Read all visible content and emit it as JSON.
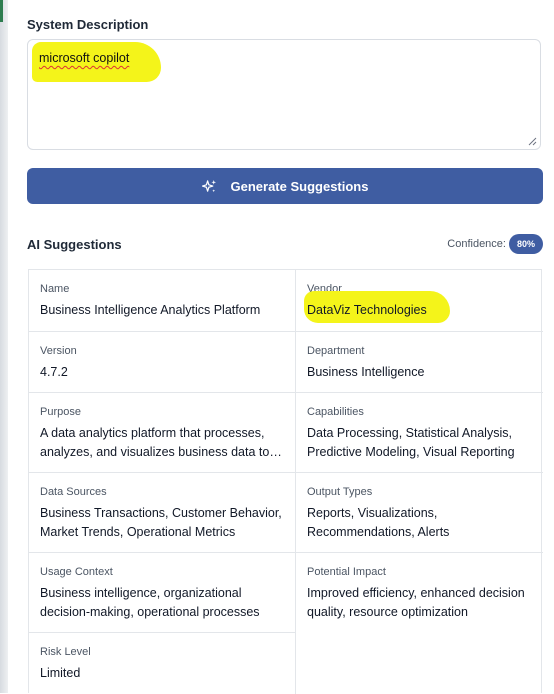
{
  "system_description": {
    "label": "System Description",
    "value": "microsoft copilot"
  },
  "generate_button": {
    "label": "Generate Suggestions",
    "icon": "sparkles-icon"
  },
  "ai_suggestions": {
    "title": "AI Suggestions",
    "confidence_label": "Confidence:",
    "confidence_value": "80%",
    "accent_color": "#3f5da2",
    "highlight_color": "#f4f41a",
    "fields": {
      "name": {
        "label": "Name",
        "value": "Business Intelligence Analytics Platform"
      },
      "vendor": {
        "label": "Vendor",
        "value": "DataViz Technologies"
      },
      "version": {
        "label": "Version",
        "value": "4.7.2"
      },
      "department": {
        "label": "Department",
        "value": "Business Intelligence"
      },
      "purpose": {
        "label": "Purpose",
        "value": "A data analytics platform that processes, analyzes, and visualizes business data to generate insights"
      },
      "capabilities": {
        "label": "Capabilities",
        "value": "Data Processing, Statistical Analysis, Predictive Modeling, Visual Reporting"
      },
      "data_sources": {
        "label": "Data Sources",
        "value": "Business Transactions, Customer Behavior, Market Trends, Operational Metrics"
      },
      "output_types": {
        "label": "Output Types",
        "value": "Reports, Visualizations, Recommendations, Alerts"
      },
      "usage_context": {
        "label": "Usage Context",
        "value": "Business intelligence, organizational decision-making, operational processes"
      },
      "potential_impact": {
        "label": "Potential Impact",
        "value": "Improved efficiency, enhanced decision quality, resource optimization"
      },
      "risk_level": {
        "label": "Risk Level",
        "value": "Limited"
      }
    }
  }
}
